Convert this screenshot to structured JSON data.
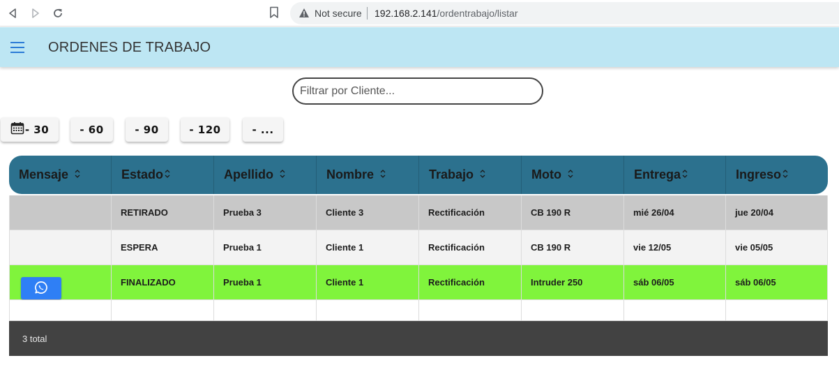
{
  "browser": {
    "not_secure": "Not secure",
    "url_host": "192.168.2.141",
    "url_path": "/ordentrabajo/listar"
  },
  "app": {
    "title": "ORDENES DE TRABAJO"
  },
  "search": {
    "placeholder": "Filtrar por Cliente..."
  },
  "filters": [
    {
      "label": "- 30",
      "icon": "calendar-icon"
    },
    {
      "label": "- 60"
    },
    {
      "label": "- 90"
    },
    {
      "label": "- 120"
    },
    {
      "label": "- ..."
    }
  ],
  "table": {
    "columns": [
      "Mensaje",
      "Estado",
      "Apellido",
      "Nombre",
      "Trabajo",
      "Moto",
      "Entrega",
      "Ingreso"
    ],
    "rows": [
      {
        "mensaje": "",
        "estado": "RETIRADO",
        "apellido": "Prueba 3",
        "nombre": "Cliente 3",
        "trabajo": "Rectificación",
        "moto": "CB 190 R",
        "entrega": "mié 26/04",
        "ingreso": "jue 20/04",
        "bg": "#c8c8c8"
      },
      {
        "mensaje": "",
        "estado": "ESPERA",
        "apellido": "Prueba 1",
        "nombre": "Cliente 1",
        "trabajo": "Rectificación",
        "moto": "CB 190 R",
        "entrega": "vie 12/05",
        "ingreso": "vie 05/05",
        "bg": "#f3f3f3"
      },
      {
        "mensaje": "whatsapp-icon",
        "estado": "FINALIZADO",
        "apellido": "Prueba 1",
        "nombre": "Cliente 1",
        "trabajo": "Rectificación",
        "moto": "Intruder 250",
        "entrega": "sáb 06/05",
        "ingreso": "sáb 06/05",
        "bg": "#80f43c"
      }
    ]
  },
  "footer": {
    "total": "3 total"
  },
  "colors": {
    "app_bar": "#bde6f3",
    "table_header": "#2c718e",
    "finalizado": "#80f43c",
    "retirado": "#c8c8c8",
    "whatsapp_button": "#2f7ff5",
    "footer": "#424242"
  }
}
